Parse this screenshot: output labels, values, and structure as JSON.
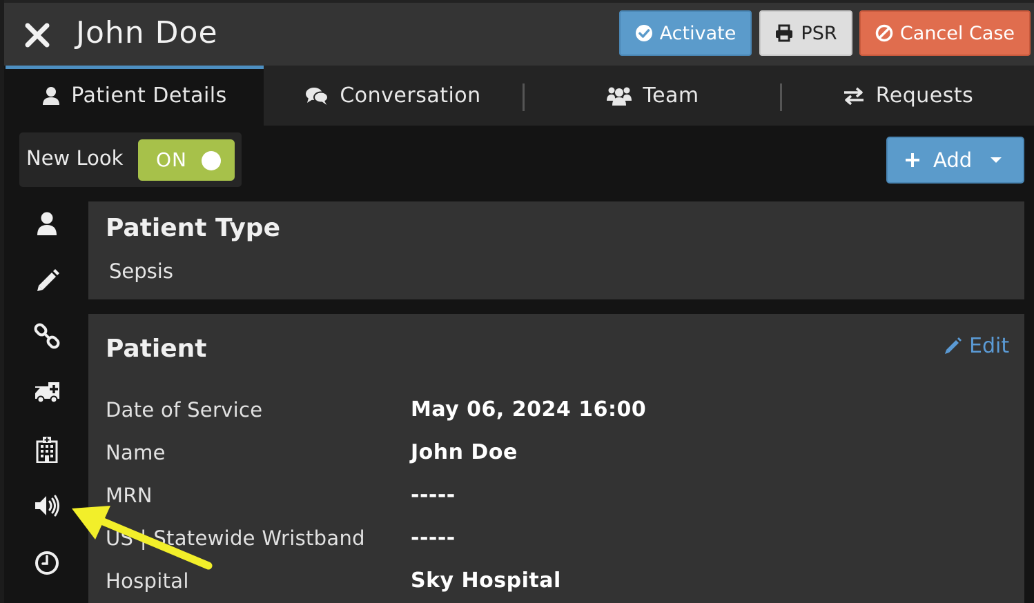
{
  "header": {
    "title": "John Doe",
    "buttons": {
      "activate": "Activate",
      "psr": "PSR",
      "cancel_case": "Cancel Case"
    }
  },
  "tabs": [
    {
      "label": "Patient Details",
      "icon": "user-icon",
      "active": true
    },
    {
      "label": "Conversation",
      "icon": "comments-icon",
      "active": false
    },
    {
      "label": "Team",
      "icon": "users-icon",
      "active": false
    },
    {
      "label": "Requests",
      "icon": "exchange-icon",
      "active": false
    }
  ],
  "toggle": {
    "label": "New Look",
    "state": "ON"
  },
  "add_button": {
    "label": "Add"
  },
  "sidebar_icons": [
    "user-icon",
    "pencil-icon",
    "link-icon",
    "ambulance-icon",
    "hospital-icon",
    "volume-icon",
    "clock-icon"
  ],
  "patient_type": {
    "title": "Patient Type",
    "value": "Sepsis"
  },
  "patient": {
    "title": "Patient",
    "edit_label": "Edit",
    "fields": [
      {
        "label": "Date of Service",
        "value": "May 06, 2024 16:00"
      },
      {
        "label": "Name",
        "value": "John Doe"
      },
      {
        "label": "MRN",
        "value": "-----"
      },
      {
        "label": "US | Statewide Wristband",
        "value": "-----"
      },
      {
        "label": "Hospital",
        "value": "Sky Hospital"
      }
    ]
  },
  "colors": {
    "activate": "#5b9bcb",
    "cancel": "#e06d4e",
    "toggle_on": "#a7c14a",
    "link": "#5b9bd6",
    "annotation_arrow": "#f2ef2a"
  }
}
